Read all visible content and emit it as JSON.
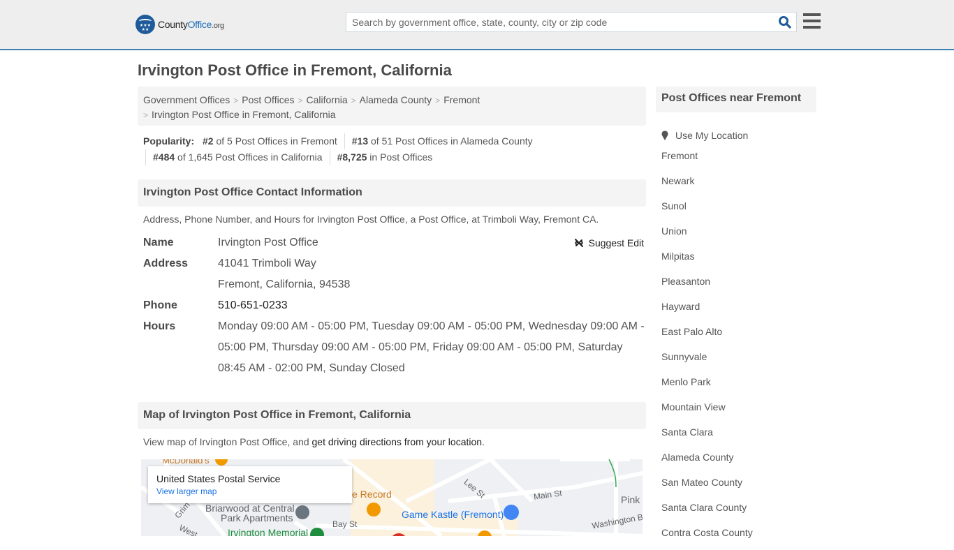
{
  "header": {
    "logo": {
      "brand_prefix": "County",
      "brand_main": "Office",
      "brand_tld": ".org",
      "stars": "★★★\n★★"
    },
    "search": {
      "placeholder": "Search by government office, state, county, city or zip code",
      "value": ""
    },
    "icons": {
      "search": "search-icon",
      "menu": "hamburger-menu-icon"
    }
  },
  "page": {
    "title": "Irvington Post Office in Fremont, California"
  },
  "breadcrumb": {
    "items": [
      "Government Offices",
      "Post Offices",
      "California",
      "Alameda County",
      "Fremont"
    ],
    "current": "Irvington Post Office in Fremont, California",
    "separator": ">"
  },
  "popularity": {
    "label": "Popularity:",
    "items": [
      {
        "rank": "#2",
        "text": " of 5 Post Offices in Fremont"
      },
      {
        "rank": "#13",
        "text": " of 51 Post Offices in Alameda County"
      },
      {
        "rank": "#484",
        "text": " of 1,645 Post Offices in California"
      },
      {
        "rank": "#8,725",
        "text": " in Post Offices"
      }
    ]
  },
  "contact": {
    "heading": "Irvington Post Office Contact Information",
    "description": "Address, Phone Number, and Hours for Irvington Post Office, a Post Office, at Trimboli Way, Fremont CA.",
    "suggest_edit": "Suggest Edit",
    "name_label": "Name",
    "name": "Irvington Post Office",
    "address_label": "Address",
    "address_line1": "41041 Trimboli Way",
    "address_line2": "Fremont, California, 94538",
    "phone_label": "Phone",
    "phone": "510-651-0233",
    "hours_label": "Hours",
    "hours": "Monday 09:00 AM - 05:00 PM, Tuesday 09:00 AM - 05:00 PM, Wednesday 09:00 AM - 05:00 PM, Thursday 09:00 AM - 05:00 PM, Friday 09:00 AM - 05:00 PM, Saturday 08:45 AM - 02:00 PM, Sunday Closed"
  },
  "map_section": {
    "heading": "Map of Irvington Post Office in Fremont, California",
    "desc_prefix": "View map of Irvington Post Office, and ",
    "desc_link": "get driving directions from your location",
    "desc_suffix": ".",
    "card_title": "United States Postal Service",
    "card_link": "View larger map",
    "labels": {
      "mcdonalds": "McDonald's",
      "record": "e Record",
      "briarwood1": "Briarwood at Central",
      "briarwood2": "Park Apartments",
      "bay": "Bay St",
      "irvington": "Irvington Memorial",
      "lee": "Lee St",
      "main": "Main St",
      "game": "Game Kastle (Fremont)",
      "pink": "Pink",
      "washington": "Washington B",
      "grimmer": "Grim",
      "west": "West"
    }
  },
  "sidebar": {
    "heading": "Post Offices near Fremont",
    "use_location": "Use My Location",
    "links": [
      "Fremont",
      "Newark",
      "Sunol",
      "Union",
      "Milpitas",
      "Pleasanton",
      "Hayward",
      "East Palo Alto",
      "Sunnyvale",
      "Menlo Park",
      "Mountain View",
      "Santa Clara",
      "Alameda County",
      "San Mateo County",
      "Santa Clara County",
      "Contra Costa County"
    ]
  }
}
